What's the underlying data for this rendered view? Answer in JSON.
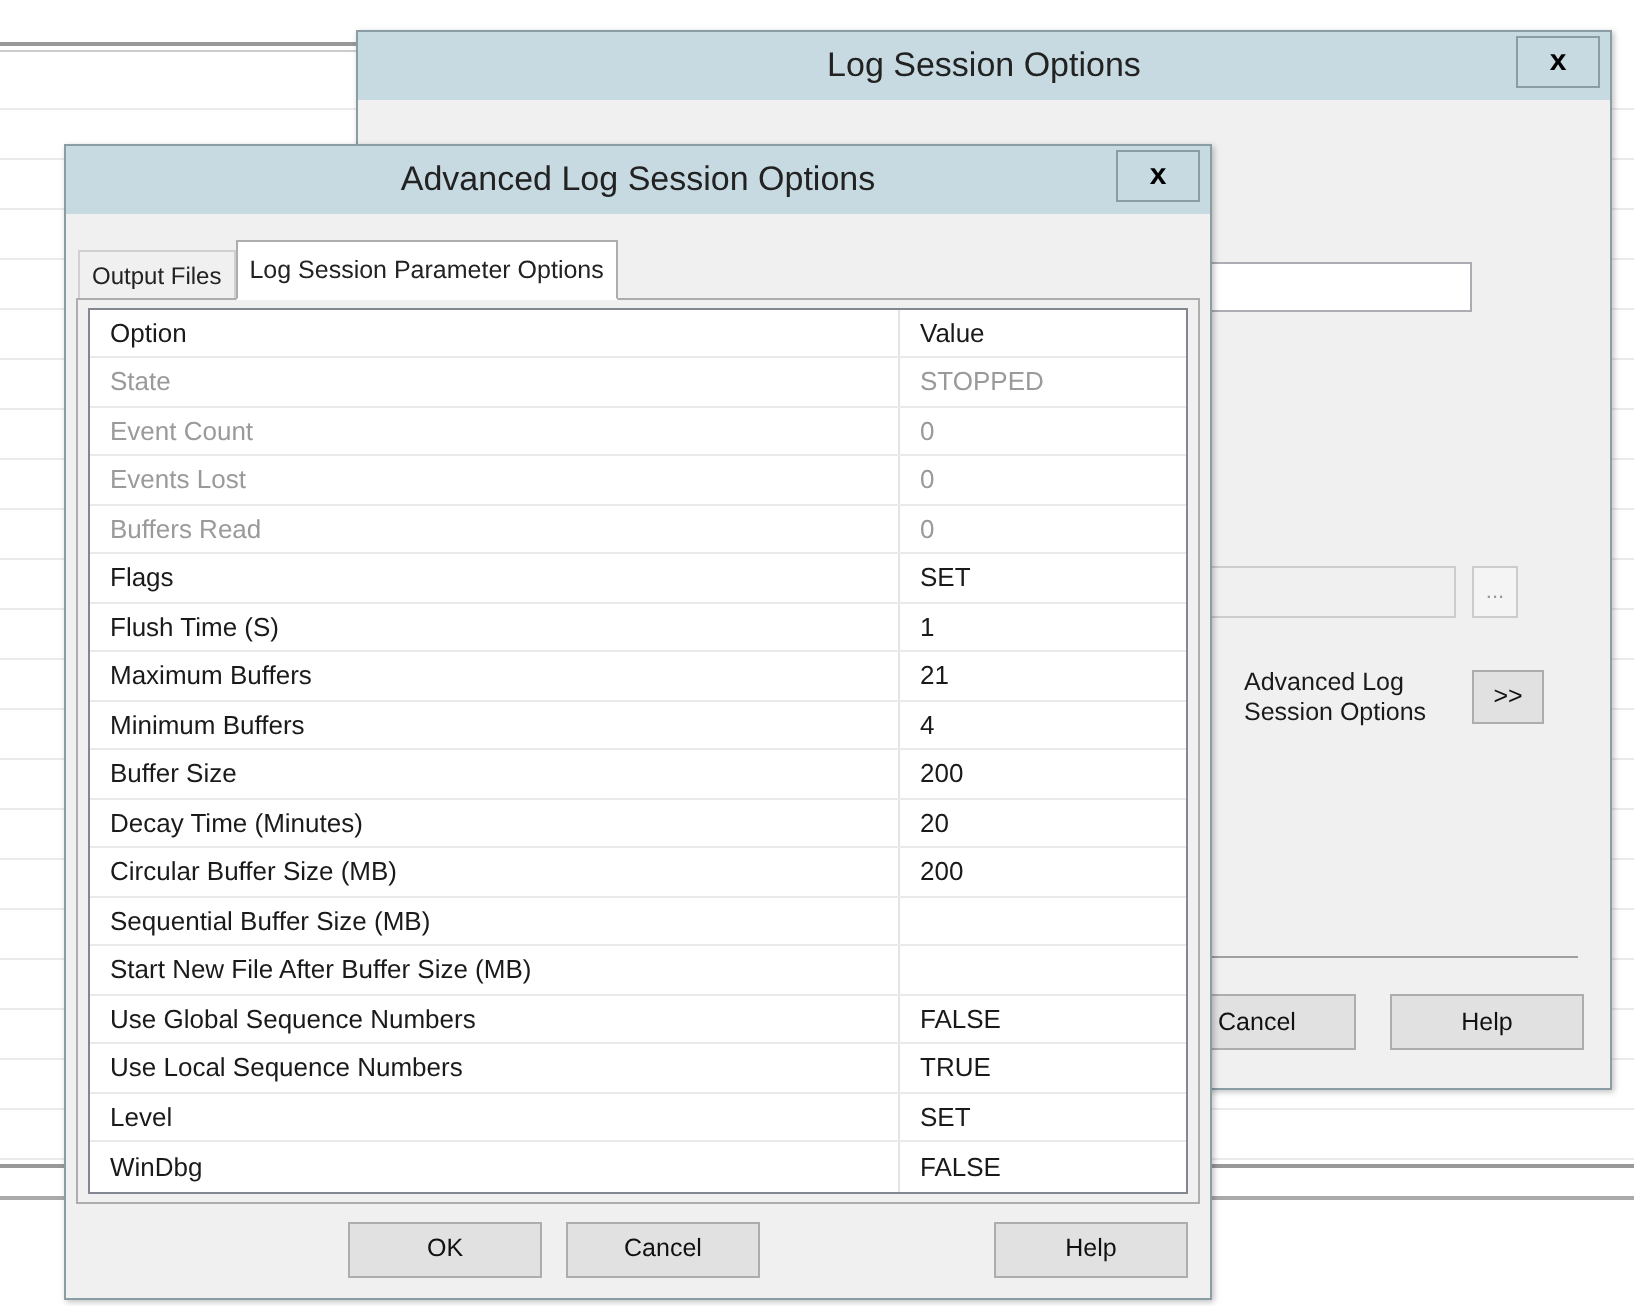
{
  "log_session_window": {
    "title": "Log Session Options",
    "close": "x",
    "path_field": {
      "disabled": true
    },
    "browse_button": "...",
    "advanced_label": "Advanced Log Session Options",
    "advanced_button": ">>",
    "buttons": [
      "Cancel",
      "Help"
    ]
  },
  "advanced_window": {
    "title": "Advanced Log Session Options",
    "close": "x",
    "tabs": [
      {
        "label": "Output Files",
        "selected": false
      },
      {
        "label": "Log Session Parameter Options",
        "selected": true
      }
    ],
    "table": {
      "columns": [
        "Option",
        "Value"
      ],
      "rows": [
        {
          "option": "State",
          "value": "STOPPED",
          "disabled": true
        },
        {
          "option": "Event Count",
          "value": "0",
          "disabled": true
        },
        {
          "option": "Events Lost",
          "value": "0",
          "disabled": true
        },
        {
          "option": "Buffers Read",
          "value": "0",
          "disabled": true
        },
        {
          "option": "Flags",
          "value": "SET",
          "disabled": false
        },
        {
          "option": "Flush Time (S)",
          "value": "1",
          "disabled": false
        },
        {
          "option": "Maximum Buffers",
          "value": "21",
          "disabled": false
        },
        {
          "option": "Minimum Buffers",
          "value": "4",
          "disabled": false
        },
        {
          "option": "Buffer Size",
          "value": "200",
          "disabled": false
        },
        {
          "option": "Decay Time (Minutes)",
          "value": "20",
          "disabled": false
        },
        {
          "option": "Circular Buffer Size (MB)",
          "value": "200",
          "disabled": false
        },
        {
          "option": "Sequential Buffer Size (MB)",
          "disabled": false
        },
        {
          "option": "Start New File After Buffer Size (MB)",
          "disabled": false
        },
        {
          "option": "Use Global Sequence Numbers",
          "value": "FALSE",
          "disabled": false
        },
        {
          "option": "Use Local Sequence Numbers",
          "value": "TRUE",
          "disabled": false
        },
        {
          "option": "Level",
          "value": "SET",
          "disabled": false
        },
        {
          "option": "WinDbg",
          "value": "FALSE",
          "disabled": false
        }
      ]
    },
    "buttons": [
      "OK",
      "Cancel",
      "Help"
    ]
  }
}
